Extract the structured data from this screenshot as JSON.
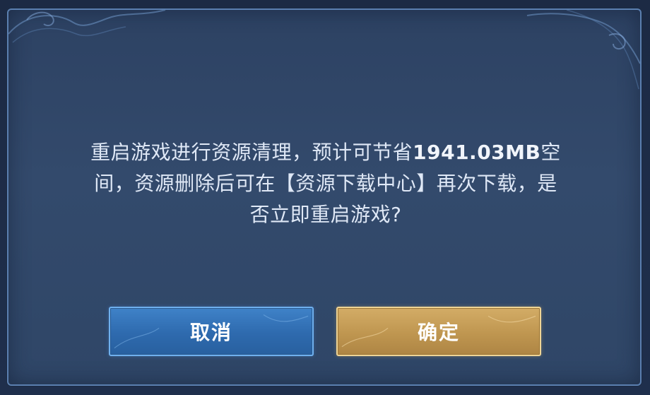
{
  "dialog": {
    "message_lines": [
      "重启游戏进行资源清理，预计可节省",
      "间，资源删除后可在【资源下载中心】再次下载，是",
      "否立即重启游戏?"
    ],
    "amount": "1941.03MB",
    "amount_suffix": "空"
  },
  "buttons": {
    "cancel_label": "取消",
    "confirm_label": "确定"
  },
  "colors": {
    "dialog_bg": "#334a6c",
    "dialog_border": "#5b7fb0",
    "cancel_button": "#2e6aae",
    "confirm_button": "#bf9650",
    "text": "#dfe8f6"
  }
}
